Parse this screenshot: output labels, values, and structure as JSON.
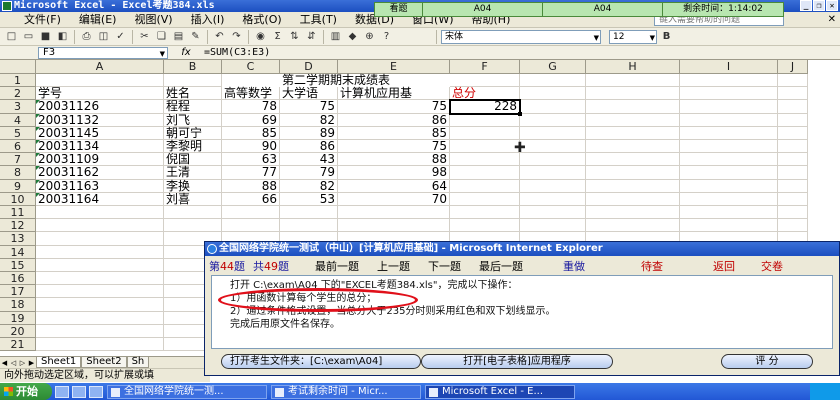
{
  "window": {
    "title": "Microsoft Excel - Excel考题384.xls"
  },
  "menu": [
    "文件(F)",
    "编辑(E)",
    "视图(V)",
    "插入(I)",
    "格式(O)",
    "工具(T)",
    "数据(D)",
    "窗口(W)",
    "帮助(H)"
  ],
  "help_box": "键入需要帮助的问题",
  "exam_bar": {
    "status": "看题",
    "code1": "A04",
    "code2": "A04",
    "time_label": "剩余时间：",
    "time_value": "1:14:02"
  },
  "toolbar": {
    "font": "宋体",
    "size": "12",
    "autosum": "Σ"
  },
  "formula_bar": {
    "name_box": "F3",
    "fx": "fx",
    "formula": "=SUM(C3:E3)"
  },
  "columns": [
    "A",
    "B",
    "C",
    "D",
    "E",
    "F",
    "G",
    "H",
    "I",
    "J"
  ],
  "rows": [
    "1",
    "2",
    "3",
    "4",
    "5",
    "6",
    "7",
    "8",
    "9",
    "10",
    "11",
    "12",
    "13",
    "14",
    "15",
    "16",
    "17",
    "18",
    "19",
    "20",
    "21"
  ],
  "sheet": {
    "title": "第二学期期末成绩表",
    "headers": [
      "学号",
      "姓名",
      "高等数学",
      "大学语",
      "计算机应用基",
      "总分"
    ],
    "data": [
      [
        "20031126",
        "程程",
        "78",
        "75",
        "75",
        "228"
      ],
      [
        "20031132",
        "刘飞",
        "69",
        "82",
        "86",
        ""
      ],
      [
        "20031145",
        "朝可宁",
        "85",
        "89",
        "85",
        ""
      ],
      [
        "20031134",
        "李黎明",
        "90",
        "86",
        "75",
        ""
      ],
      [
        "20031109",
        "倪国",
        "63",
        "43",
        "88",
        ""
      ],
      [
        "20031162",
        "王清",
        "77",
        "79",
        "98",
        ""
      ],
      [
        "20031163",
        "李换",
        "88",
        "82",
        "64",
        ""
      ],
      [
        "20031164",
        "刘喜",
        "66",
        "53",
        "70",
        ""
      ]
    ]
  },
  "sheet_tabs": [
    "Sheet1",
    "Sheet2",
    "Sh"
  ],
  "status_bar": "向外拖动选定区域，可以扩展或填",
  "taskbar": {
    "start": "开始",
    "tasks": [
      "全国网络学院统一测...",
      "考试剩余时间 - Micr...",
      "Microsoft Excel - E..."
    ]
  },
  "dialog": {
    "title": "全国网络学院统一测试（中山）[计算机应用基础] - Microsoft Internet Explorer",
    "question_no_label": "第",
    "question_no": "44",
    "question_no_suffix": "题",
    "total_label": "共",
    "total": "49",
    "total_suffix": "题",
    "nav": [
      "最前一题",
      "上一题",
      "下一题",
      "最后一题"
    ],
    "redo": "重做",
    "review": "待查",
    "back": "返回",
    "submit": "交卷",
    "instructions": [
      "打开 C:\\exam\\A04 下的\"EXCEL考题384.xls\"，完成以下操作：",
      "1）用函数计算每个学生的总分；",
      "2）通过条件格式设置，当总分大于235分时则采用红色和双下划线显示。",
      "完成后用原文件名保存。"
    ],
    "buttons": {
      "open_folder": "打开考生文件夹：[C:\\exam\\A04]",
      "open_app": "打开[电子表格]应用程序",
      "grade": "评 分"
    }
  }
}
